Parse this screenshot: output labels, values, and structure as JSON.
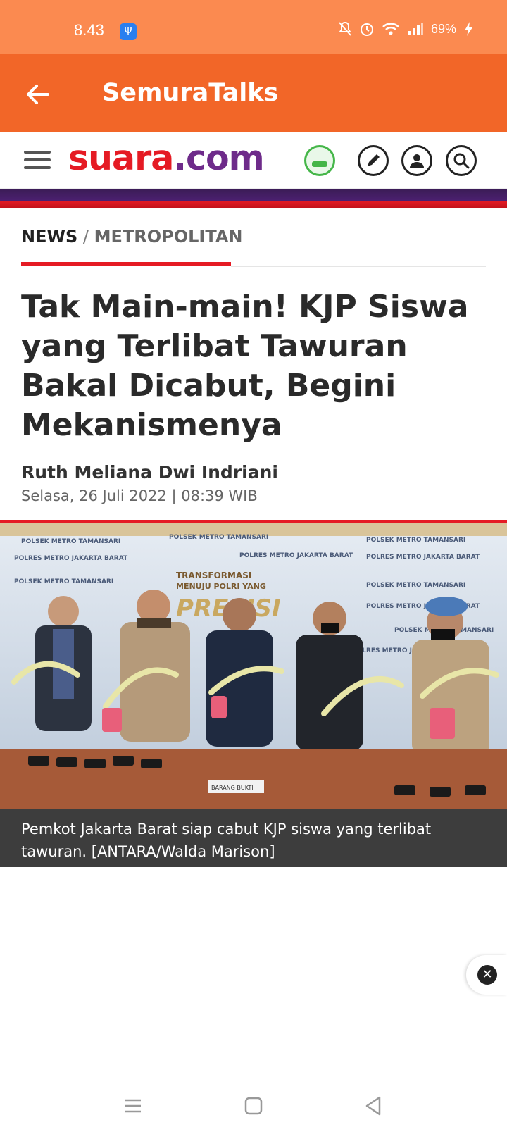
{
  "status_bar": {
    "time": "8.43",
    "battery": "69%",
    "icons": [
      "usb-icon",
      "mute-icon",
      "alarm-icon",
      "wifi-icon",
      "signal-icon",
      "charging-icon"
    ]
  },
  "app_bar": {
    "title": "SemuraTalks",
    "back_icon": "arrow-left-icon",
    "background": "#f26628"
  },
  "site_header": {
    "logo_part1": "suara",
    "logo_part2": ".com",
    "icons": [
      "menu-icon",
      "pencil-icon",
      "user-icon",
      "search-icon"
    ]
  },
  "breadcrumb": {
    "section": "NEWS",
    "separator": " / ",
    "category": "METROPOLITAN"
  },
  "article": {
    "headline": "Tak Main-main! KJP Siswa yang Terlibat Tawuran Bakal Dicabut, Begini Mekanismenya",
    "author": "Ruth Meliana Dwi Indriani",
    "date": "Selasa, 26 Juli 2022 | 08:39 WIB",
    "photo_caption": "Pemkot Jakarta Barat siap cabut KJP siswa yang terlibat tawuran. [ANTARA/Walda Marison]"
  },
  "photo_backdrop": {
    "banner_line_1": "POLSEK METRO TAMANSARI",
    "banner_line_2": "POLRES METRO JAKARTA BARAT",
    "center_text_1": "TRANSFORMASI",
    "center_text_2": "MENUJU POLRI YANG",
    "center_text_3": "PRESISI",
    "table_label": "BARANG BUKTI"
  },
  "colors": {
    "accent_red": "#e51b24",
    "brand_purple": "#6e2b8a",
    "status_orange": "#fb8a50"
  },
  "nav_bar": {
    "icons": [
      "recents-icon",
      "home-icon",
      "back-icon"
    ]
  }
}
